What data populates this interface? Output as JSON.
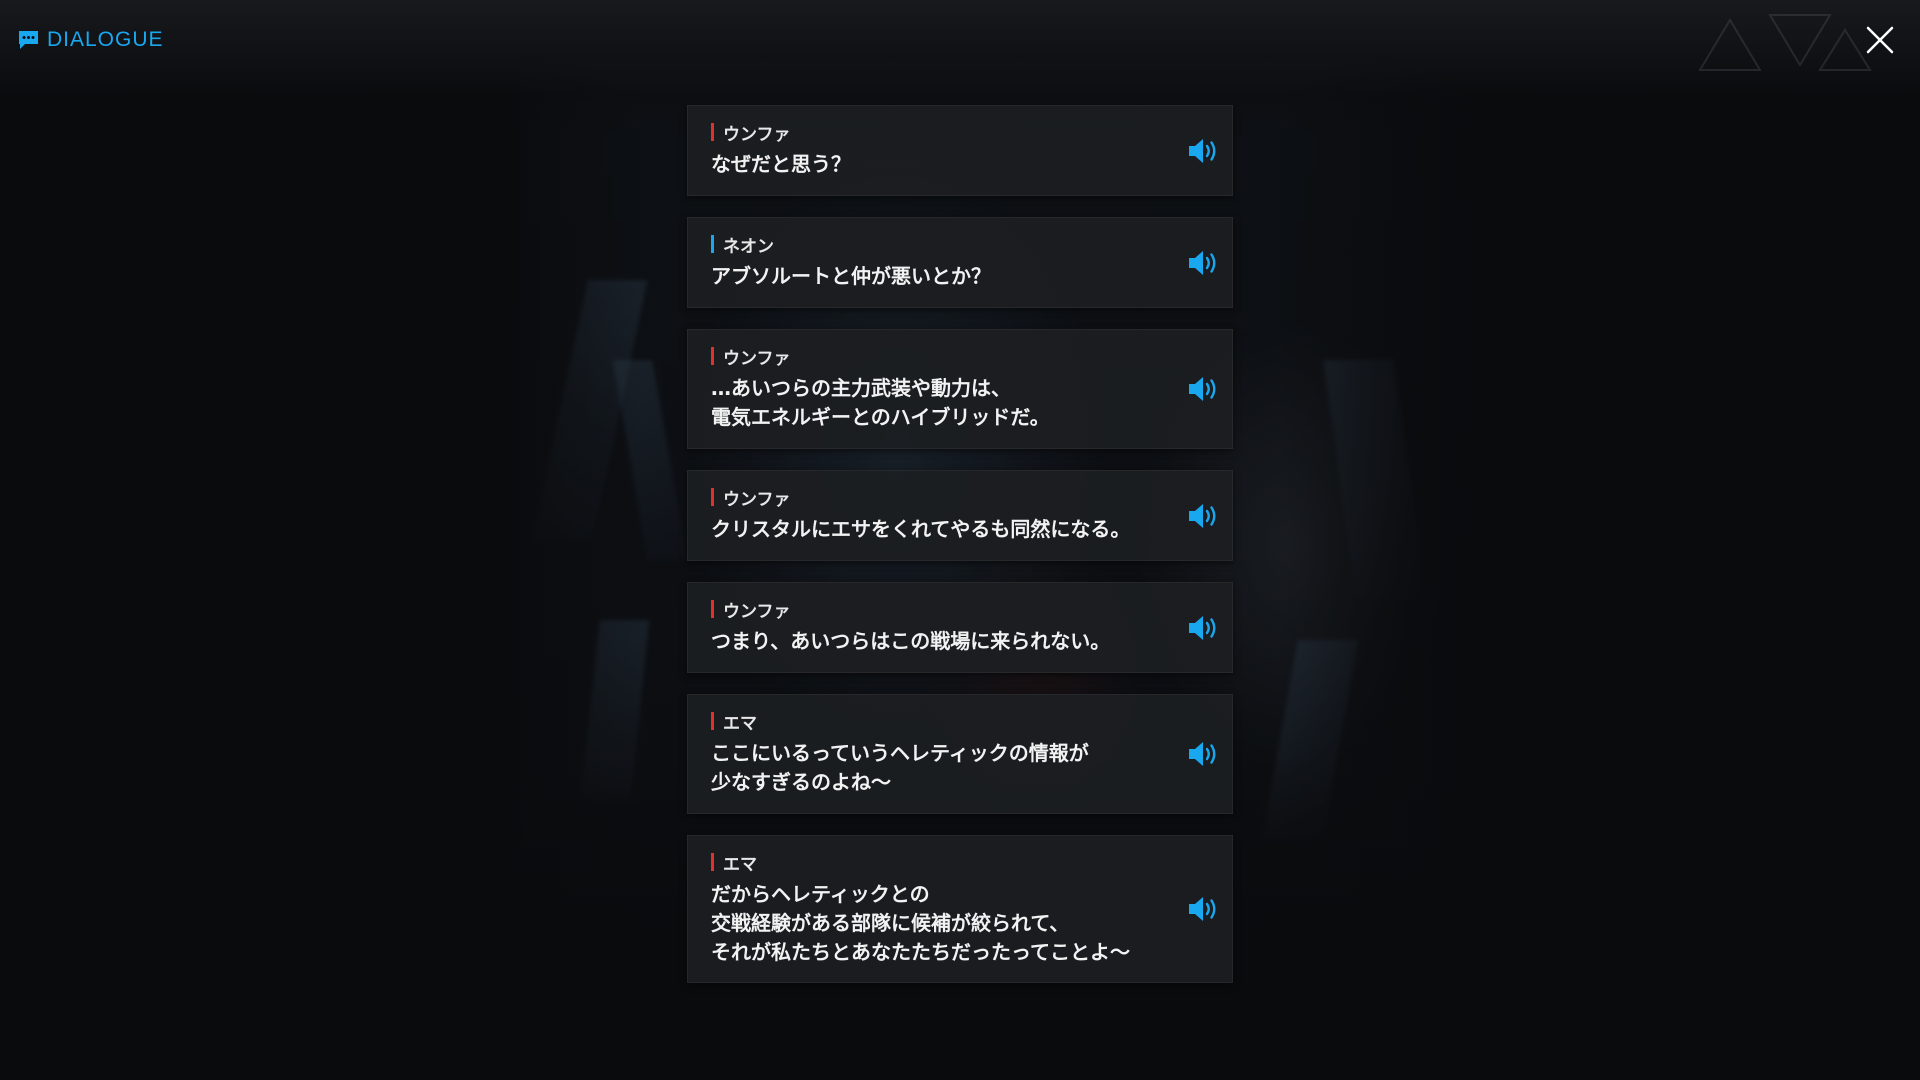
{
  "header": {
    "title": "DIALOGUE",
    "icon": "chat-bubble-icon",
    "accent_color": "#19a7f0"
  },
  "close": {
    "icon": "close-icon"
  },
  "speaker_colors": {
    "red": "#e2302a",
    "blue": "#19a7f0"
  },
  "dialogue": [
    {
      "speaker": "ウンファ",
      "bar": "red",
      "text": "なぜだと思う？"
    },
    {
      "speaker": "ネオン",
      "bar": "blue",
      "text": "アブソルートと仲が悪いとか？"
    },
    {
      "speaker": "ウンファ",
      "bar": "red",
      "text": "…あいつらの主力武装や動力は、\n電気エネルギーとのハイブリッドだ。"
    },
    {
      "speaker": "ウンファ",
      "bar": "red",
      "text": "クリスタルにエサをくれてやるも同然になる。"
    },
    {
      "speaker": "ウンファ",
      "bar": "red",
      "text": "つまり、あいつらはこの戦場に来られない。"
    },
    {
      "speaker": "エマ",
      "bar": "red",
      "text": "ここにいるっていうヘレティックの情報が\n少なすぎるのよね～"
    },
    {
      "speaker": "エマ",
      "bar": "red",
      "text": "だからヘレティックとの\n交戦経験がある部隊に候補が絞られて、\nそれが私たちとあなたたちだったってことよ～"
    }
  ],
  "voice_icon": "speaker-volume-icon"
}
